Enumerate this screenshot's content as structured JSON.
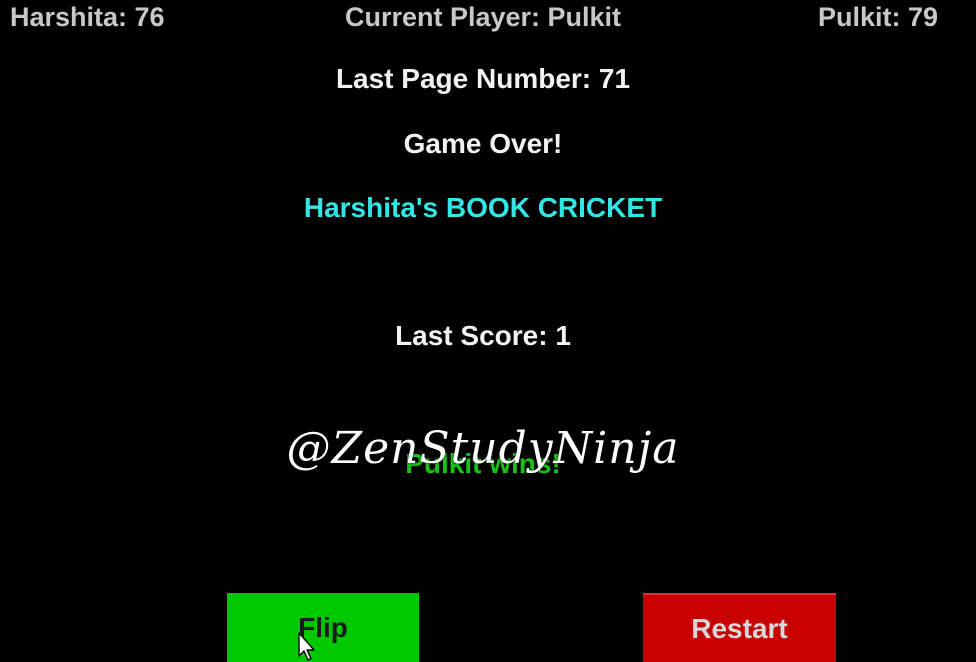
{
  "scoreboard": {
    "left_player": "Harshita: 76",
    "current_player": "Current Player: Pulkit",
    "right_player": "Pulkit: 79"
  },
  "status": {
    "last_page": "Last Page Number: 71",
    "game_over": "Game Over!",
    "title": "Harshita's BOOK CRICKET",
    "last_score": "Last Score: 1",
    "winner": "Pulkit wins!"
  },
  "watermark": "@ZenStudyNinja",
  "controls": {
    "flip_label": "Flip",
    "restart_label": "Restart"
  },
  "colors": {
    "background": "#000000",
    "title": "#33e6e6",
    "winner": "#18c018",
    "flip_button": "#00c800",
    "restart_button": "#c80000"
  },
  "icons": {
    "cursor": "mouse-pointer-icon"
  }
}
